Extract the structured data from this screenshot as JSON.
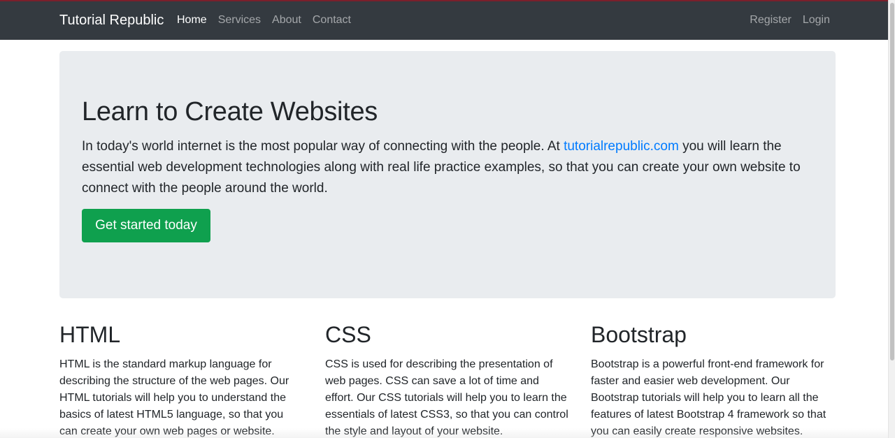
{
  "navbar": {
    "brand": "Tutorial Republic",
    "left_links": [
      {
        "label": "Home",
        "active": true
      },
      {
        "label": "Services",
        "active": false
      },
      {
        "label": "About",
        "active": false
      },
      {
        "label": "Contact",
        "active": false
      }
    ],
    "right_links": [
      {
        "label": "Register"
      },
      {
        "label": "Login"
      }
    ]
  },
  "jumbotron": {
    "title": "Learn to Create Websites",
    "lead_before": "In today's world internet is the most popular way of connecting with the people. At ",
    "lead_link": "tutorialrepublic.com",
    "lead_after": " you will learn the essential web development technologies along with real life practice examples, so that you can create your own website to connect with the people around the world.",
    "button_label": "Get started today"
  },
  "features": [
    {
      "title": "HTML",
      "text": "HTML is the standard markup language for describing the structure of the web pages. Our HTML tutorials will help you to understand the basics of latest HTML5 language, so that you can create your own web pages or website."
    },
    {
      "title": "CSS",
      "text": "CSS is used for describing the presentation of web pages. CSS can save a lot of time and effort. Our CSS tutorials will help you to learn the essentials of latest CSS3, so that you can control the style and layout of your website."
    },
    {
      "title": "Bootstrap",
      "text": "Bootstrap is a powerful front-end framework for faster and easier web development. Our Bootstrap tutorials will help you to learn all the features of latest Bootstrap 4 framework so that you can easily create responsive websites."
    }
  ],
  "colors": {
    "navbar_bg": "#343a40",
    "jumbotron_bg": "#e9ecef",
    "link": "#007bff",
    "button_success": "#0fa04e"
  }
}
